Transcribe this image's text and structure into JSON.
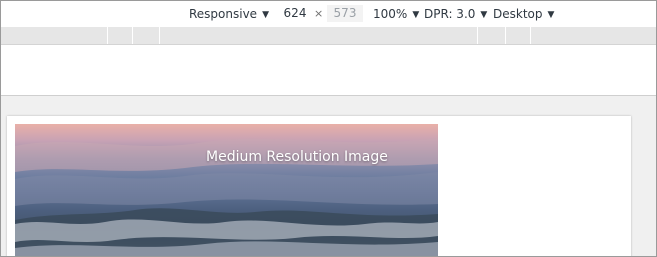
{
  "device_toolbar": {
    "device_mode": "Responsive",
    "width_value": "624",
    "times_symbol": "×",
    "height_value": "573",
    "zoom": "100%",
    "dpr": "DPR: 3.0",
    "device_type": "Desktop",
    "caret": "▼"
  },
  "page": {
    "hero_title": "Medium Resolution Image"
  }
}
